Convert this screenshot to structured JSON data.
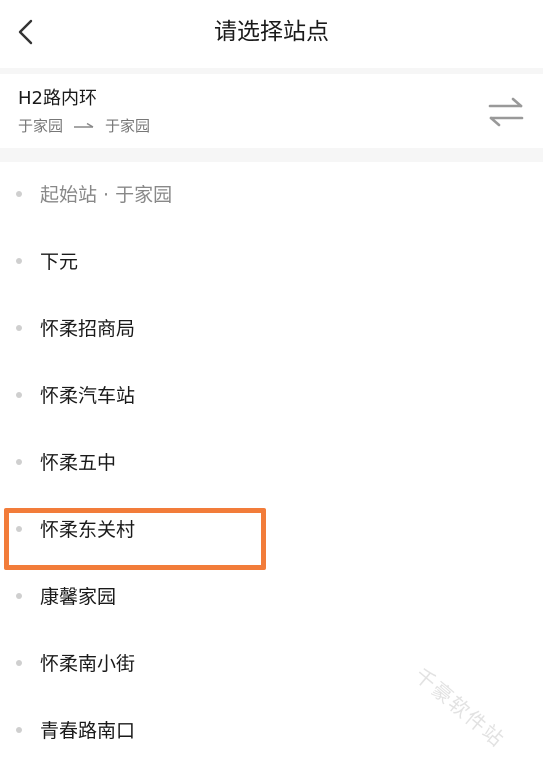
{
  "header": {
    "title": "请选择站点",
    "back_icon": "chevron-left-icon"
  },
  "route": {
    "name": "H2路内环",
    "from": "于家园",
    "to": "于家园",
    "direction_icon": "arrow-right-icon",
    "swap_icon": "swap-direction-icon"
  },
  "stops": [
    {
      "label": "起始站 · 于家园"
    },
    {
      "label": "下元"
    },
    {
      "label": "怀柔招商局"
    },
    {
      "label": "怀柔汽车站"
    },
    {
      "label": "怀柔五中"
    },
    {
      "label": "怀柔东关村"
    },
    {
      "label": "康馨家园"
    },
    {
      "label": "怀柔南小街"
    },
    {
      "label": "青春路南口"
    }
  ],
  "highlight_color": "#f27c3a",
  "watermark": "千豪软件站"
}
